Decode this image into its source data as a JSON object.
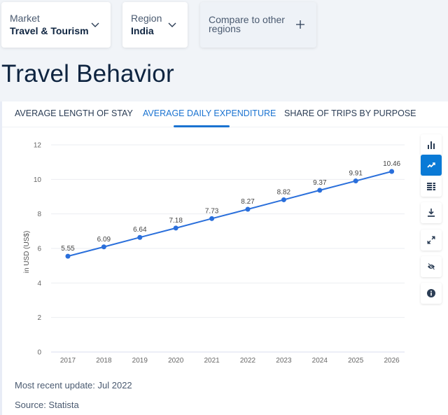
{
  "selectors": {
    "market": {
      "label": "Market",
      "value": "Travel & Tourism"
    },
    "region": {
      "label": "Region",
      "value": "India"
    },
    "compare": {
      "label": "Compare to other regions",
      "icon": "plus-icon"
    }
  },
  "page_title": "Travel Behavior",
  "tabs": [
    {
      "label": "Average Length of Stay",
      "active": false
    },
    {
      "label": "Average Daily Expenditure",
      "active": true
    },
    {
      "label": "Share of Trips by Purpose",
      "active": false
    }
  ],
  "toolbar": [
    {
      "name": "bar-chart",
      "icon": "bar-chart-icon",
      "active": false
    },
    {
      "name": "line-chart",
      "icon": "line-chart-icon",
      "active": true
    },
    {
      "name": "table-view",
      "icon": "table-icon",
      "active": false
    },
    {
      "name": "download",
      "icon": "download-icon",
      "active": false
    },
    {
      "name": "fullscreen",
      "icon": "expand-icon",
      "active": false
    },
    {
      "name": "hide",
      "icon": "eye-slash-icon",
      "active": false
    },
    {
      "name": "info",
      "icon": "info-icon",
      "active": false
    }
  ],
  "colors": {
    "accent": "#1a73d1",
    "line": "#2a6fdb",
    "active_button": "#0a7ad6"
  },
  "chart_data": {
    "type": "line",
    "title": "",
    "xlabel": "",
    "ylabel": "in USD (US$)",
    "categories": [
      "2017",
      "2018",
      "2019",
      "2020",
      "2021",
      "2022",
      "2023",
      "2024",
      "2025",
      "2026"
    ],
    "series": [
      {
        "name": "Average Daily Expenditure",
        "values": [
          5.55,
          6.09,
          6.64,
          7.18,
          7.73,
          8.27,
          8.82,
          9.37,
          9.91,
          10.46
        ]
      }
    ],
    "value_labels": [
      "5.55",
      "6.09",
      "6.64",
      "7.18",
      "7.73",
      "8.27",
      "8.82",
      "9.37",
      "9.91",
      "10.46"
    ],
    "ylim": [
      0,
      12
    ],
    "yticks": [
      0,
      2,
      4,
      6,
      8,
      10,
      12
    ],
    "grid": true,
    "legend": "none"
  },
  "footer": {
    "update": "Most recent update: Jul 2022",
    "source": "Source: Statista"
  }
}
